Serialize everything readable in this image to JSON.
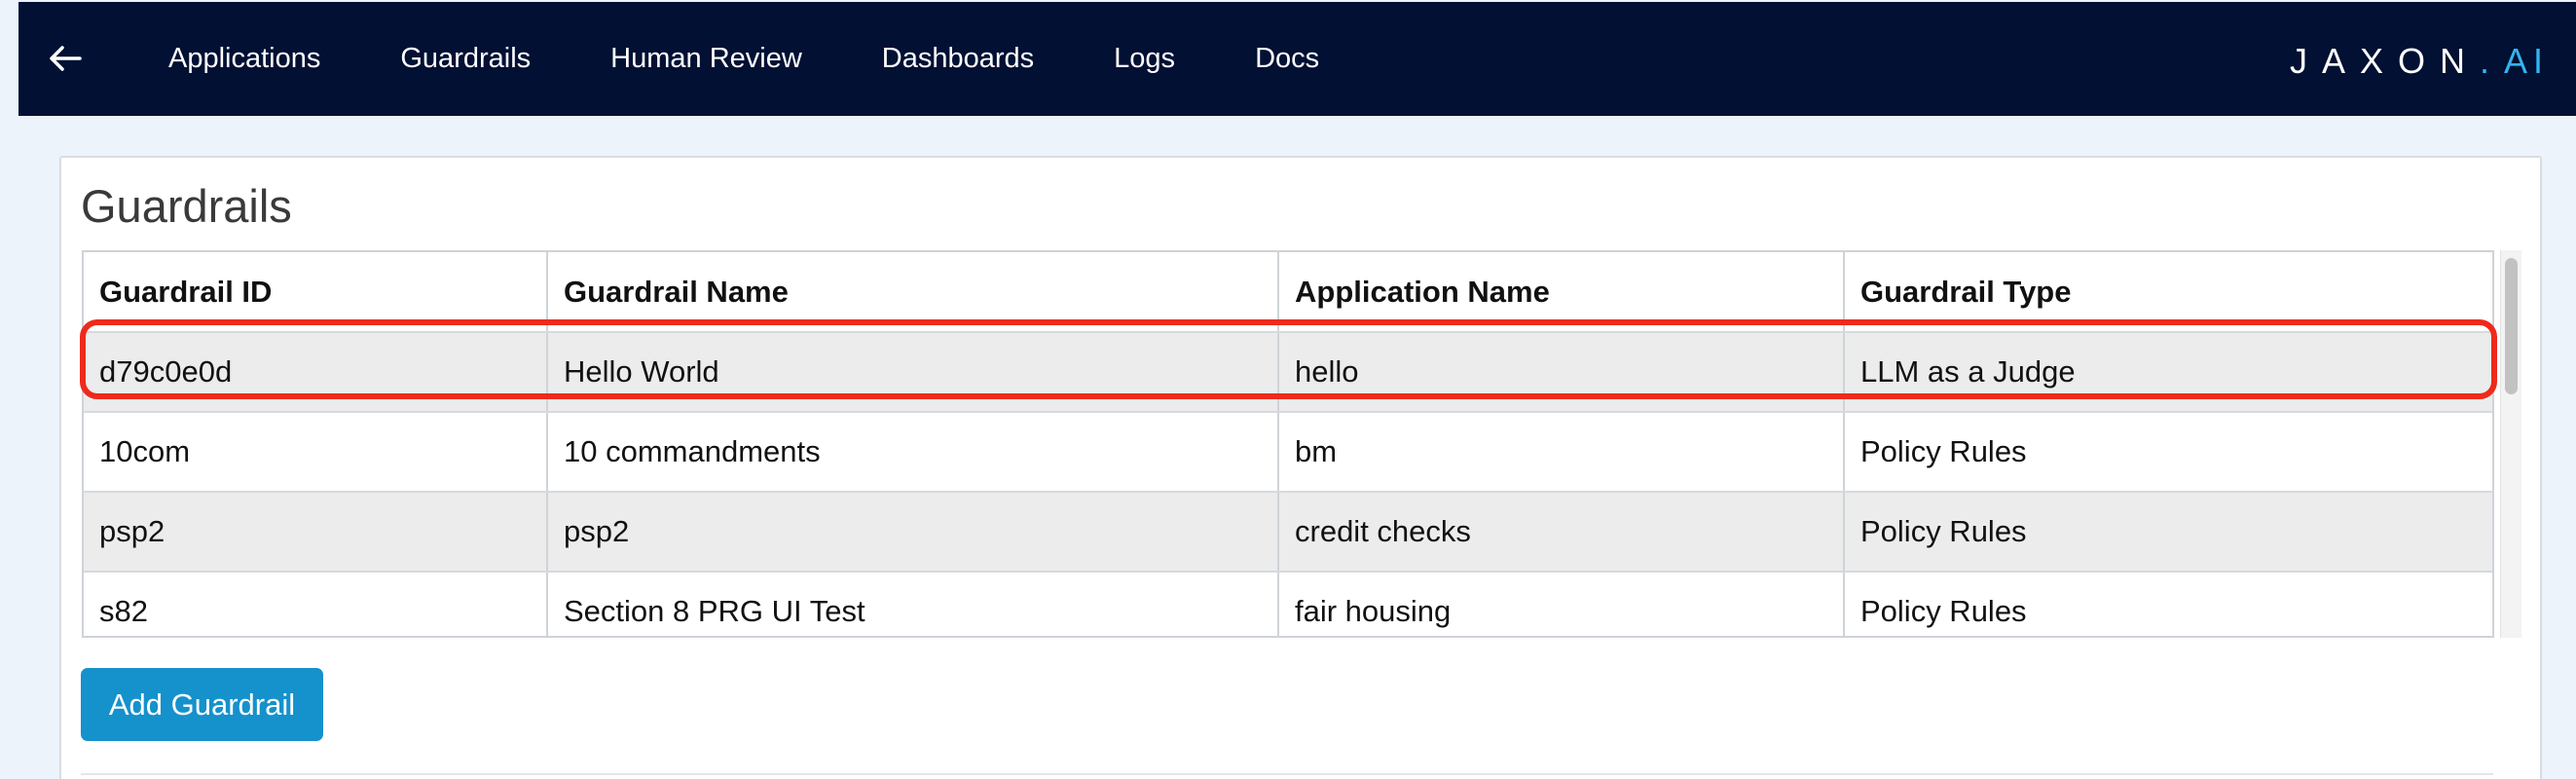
{
  "nav": {
    "back_icon": "arrow-left-icon",
    "links": [
      "Applications",
      "Guardrails",
      "Human Review",
      "Dashboards",
      "Logs",
      "Docs"
    ],
    "brand": {
      "part1": "JAXON",
      "dot": ".",
      "part2": "AI"
    }
  },
  "page": {
    "title": "Guardrails"
  },
  "table": {
    "headers": [
      "Guardrail ID",
      "Guardrail Name",
      "Application Name",
      "Guardrail Type"
    ],
    "rows": [
      [
        "d79c0e0d",
        "Hello World",
        "hello",
        "LLM as a Judge"
      ],
      [
        "10com",
        "10 commandments",
        "bm",
        "Policy Rules"
      ],
      [
        "psp2",
        "psp2",
        "credit checks",
        "Policy Rules"
      ],
      [
        "s82",
        "Section 8 PRG UI Test",
        "fair housing",
        "Policy Rules"
      ]
    ]
  },
  "actions": {
    "add_label": "Add Guardrail"
  },
  "colors": {
    "nav_bg": "#011033",
    "accent": "#1591cc",
    "highlight": "#ee2a1c"
  }
}
